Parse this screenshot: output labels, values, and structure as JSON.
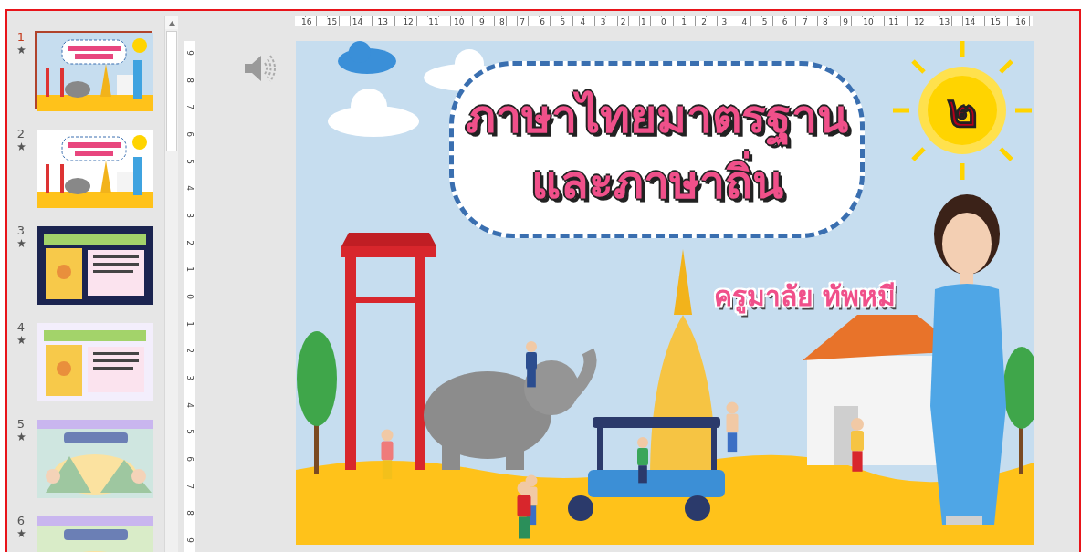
{
  "thumbnails": [
    {
      "number": "1",
      "selected": true
    },
    {
      "number": "2",
      "selected": false
    },
    {
      "number": "3",
      "selected": false
    },
    {
      "number": "4",
      "selected": false
    },
    {
      "number": "5",
      "selected": false
    },
    {
      "number": "6",
      "selected": false
    }
  ],
  "ruler_horizontal": [
    "16",
    "15",
    "14",
    "13",
    "12",
    "11",
    "10",
    "9",
    "8",
    "7",
    "6",
    "5",
    "4",
    "3",
    "2",
    "1",
    "0",
    "1",
    "2",
    "3",
    "4",
    "5",
    "6",
    "7",
    "8",
    "9",
    "10",
    "11",
    "12",
    "13",
    "14",
    "15",
    "16"
  ],
  "ruler_vertical": [
    "9",
    "8",
    "7",
    "6",
    "5",
    "4",
    "3",
    "2",
    "1",
    "0",
    "1",
    "2",
    "3",
    "4",
    "5",
    "6",
    "7",
    "8",
    "9"
  ],
  "slide": {
    "title_lines": [
      "ภาษาไทยมาตรฐาน",
      "และภาษาถิ่น"
    ],
    "badge": "๒",
    "author": "ครูมาลัย ทัพหมี"
  }
}
